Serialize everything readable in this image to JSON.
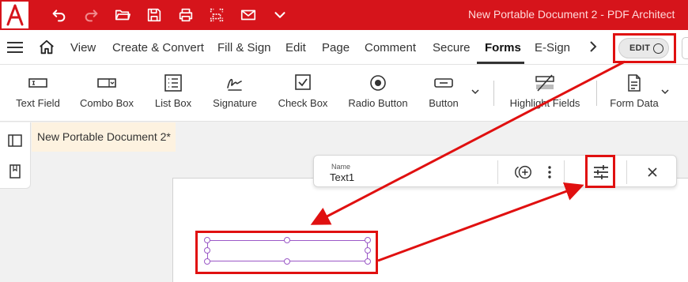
{
  "app": {
    "logo": "A",
    "title": "New Portable Document 2   -   PDF Architect"
  },
  "quick_access": [
    {
      "icon": "undo-icon"
    },
    {
      "icon": "redo-icon"
    },
    {
      "icon": "open-folder-icon"
    },
    {
      "icon": "save-icon"
    },
    {
      "icon": "print-icon"
    },
    {
      "icon": "scan-icon"
    },
    {
      "icon": "email-icon"
    },
    {
      "icon": "chevron-down-icon"
    }
  ],
  "menu": {
    "items": [
      "View",
      "Create & Convert",
      "Fill & Sign",
      "Edit",
      "Page",
      "Comment",
      "Secure",
      "Forms",
      "E-Sign"
    ],
    "active": "Forms",
    "edit_toggle_label": "EDIT"
  },
  "ribbon": {
    "tools": [
      {
        "label": "Text Field",
        "icon": "text-field-icon"
      },
      {
        "label": "Combo Box",
        "icon": "combo-box-icon"
      },
      {
        "label": "List Box",
        "icon": "list-box-icon"
      },
      {
        "label": "Signature",
        "icon": "signature-icon"
      },
      {
        "label": "Check Box",
        "icon": "check-box-icon"
      },
      {
        "label": "Radio Button",
        "icon": "radio-button-icon"
      },
      {
        "label": "Button",
        "icon": "button-icon"
      },
      {
        "label": "Highlight Fields",
        "icon": "highlight-fields-icon"
      },
      {
        "label": "Form Data",
        "icon": "form-data-icon"
      }
    ]
  },
  "document_tab": {
    "title": "New Portable Document 2*"
  },
  "field_properties": {
    "name_label": "Name",
    "name_value": "Text1"
  },
  "annotation_color": "#e01010",
  "accent": "#d6141b"
}
